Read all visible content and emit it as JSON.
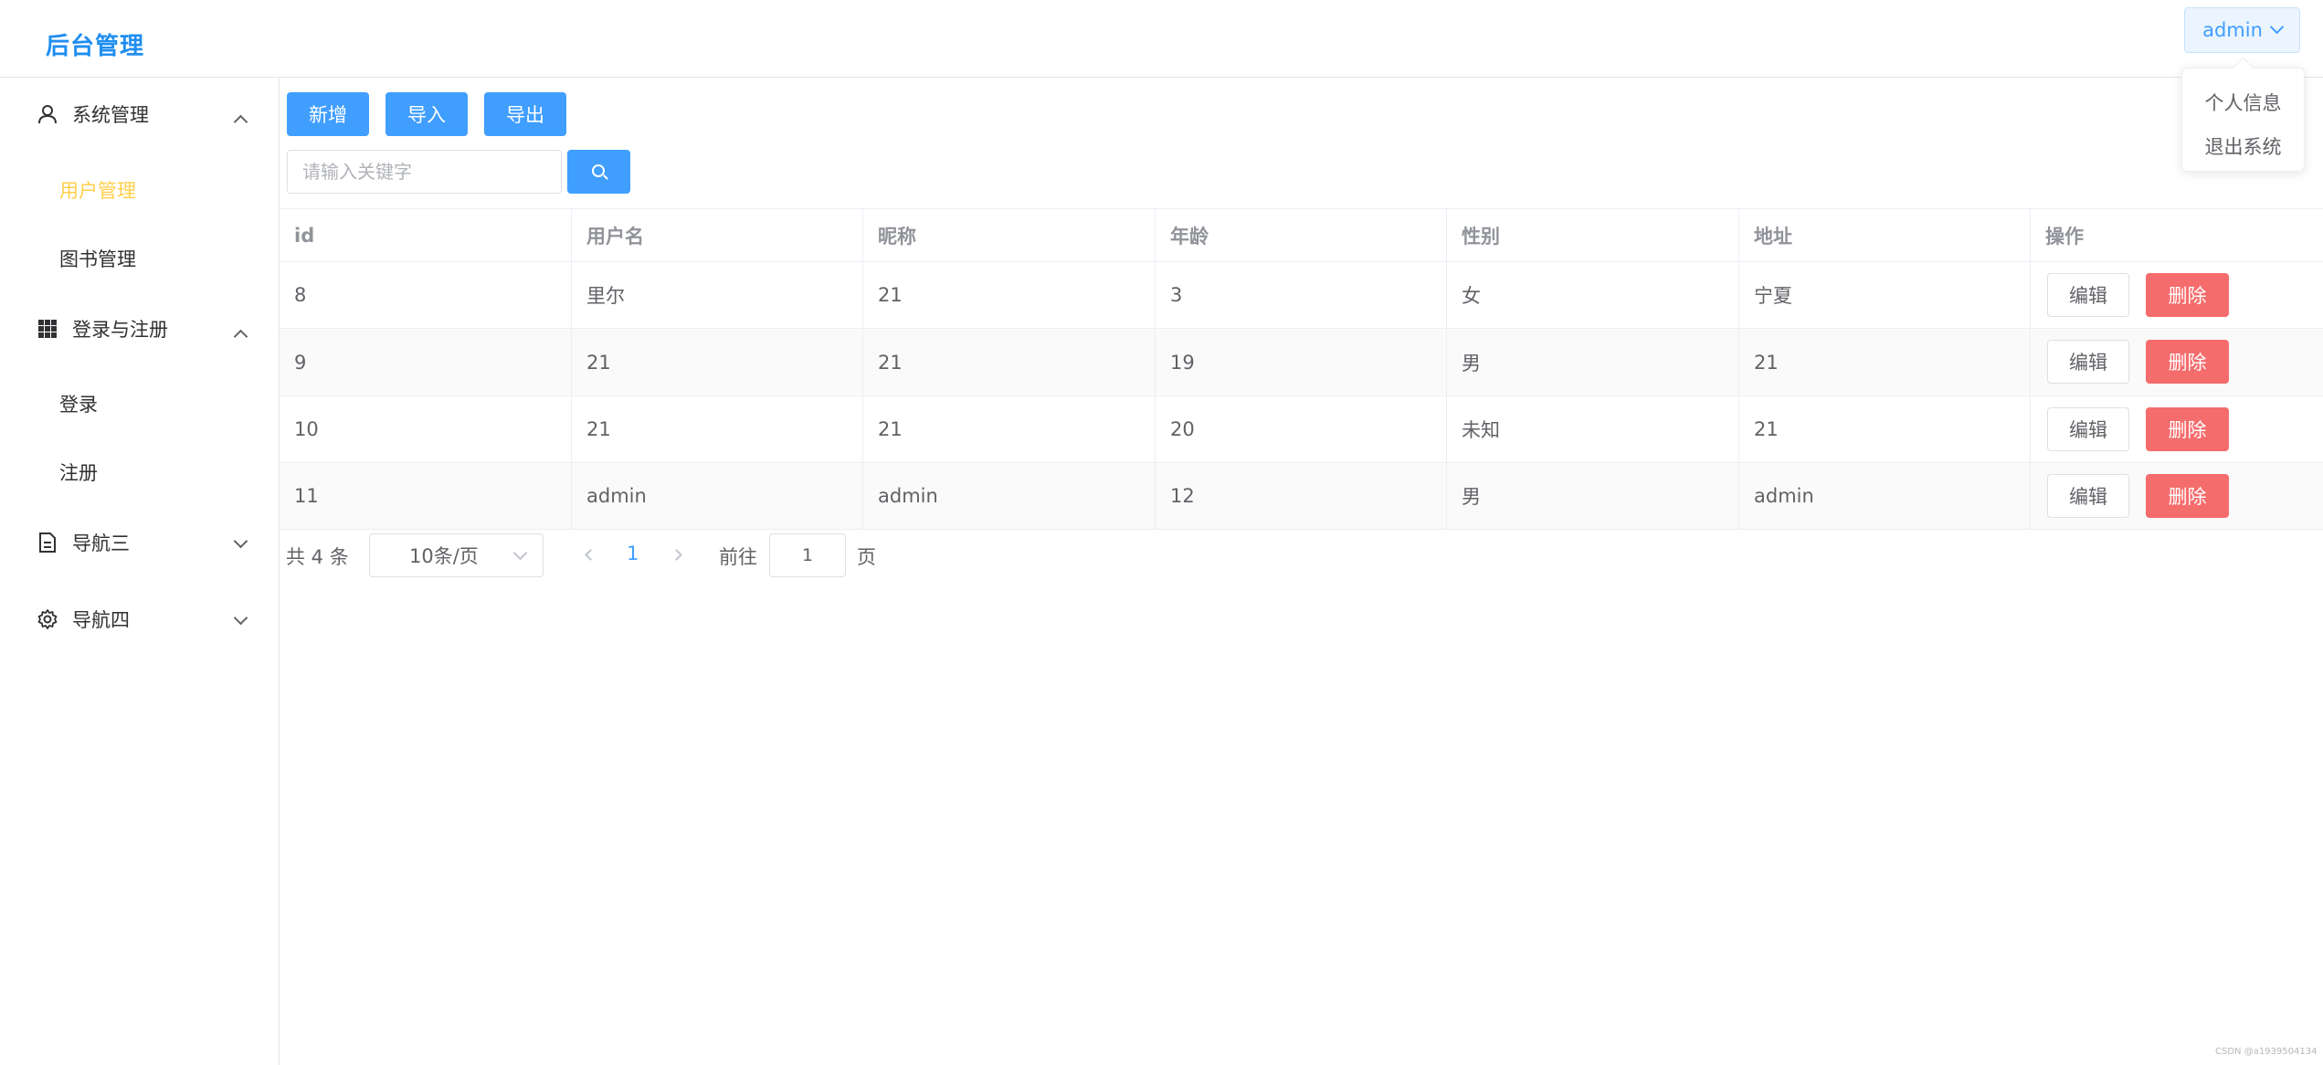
{
  "header": {
    "logo": "后台管理",
    "user_menu": {
      "label": "admin",
      "items": [
        "个人信息",
        "退出系统"
      ]
    }
  },
  "sidebar": {
    "groups": [
      {
        "label": "系统管理",
        "icon": "user-icon",
        "expanded": true,
        "items": [
          "用户管理",
          "图书管理"
        ]
      },
      {
        "label": "登录与注册",
        "icon": "grid-icon",
        "expanded": true,
        "items": [
          "登录",
          "注册"
        ]
      },
      {
        "label": "导航三",
        "icon": "document-icon",
        "expanded": false
      },
      {
        "label": "导航四",
        "icon": "gear-icon",
        "expanded": false
      }
    ],
    "active_item": "用户管理",
    "active_color": "#ffd04b"
  },
  "toolbar": {
    "add": "新增",
    "import": "导入",
    "export": "导出"
  },
  "search": {
    "placeholder": "请输入关键字",
    "icon": "search-icon"
  },
  "table": {
    "columns": [
      "id",
      "用户名",
      "昵称",
      "年龄",
      "性别",
      "地址",
      "操作"
    ],
    "rows": [
      [
        "8",
        "里尔",
        "21",
        "3",
        "女",
        "宁夏"
      ],
      [
        "9",
        "21",
        "21",
        "19",
        "男",
        "21"
      ],
      [
        "10",
        "21",
        "21",
        "20",
        "未知",
        "21"
      ],
      [
        "11",
        "admin",
        "admin",
        "12",
        "男",
        "admin"
      ]
    ],
    "actions": {
      "edit": "编辑",
      "delete": "删除"
    }
  },
  "pagination": {
    "total": "共 4 条",
    "page_size": "10条/页",
    "current_page": "1",
    "goto_label": "前往",
    "goto_value": "1",
    "page_suffix": "页"
  },
  "colors": {
    "primary": "#409eff",
    "danger": "#f56c6c",
    "brand": "#1f8ef1"
  },
  "watermark": "CSDN @a1939504134"
}
